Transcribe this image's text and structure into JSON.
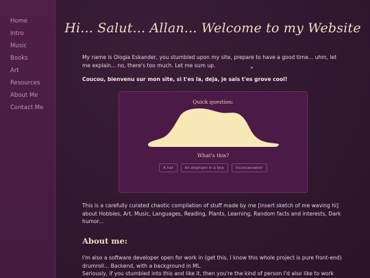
{
  "sidebar": {
    "items": [
      {
        "label": "Home"
      },
      {
        "label": "Intro"
      },
      {
        "label": "Music"
      },
      {
        "label": "Books"
      },
      {
        "label": "Art"
      },
      {
        "label": "Resources"
      },
      {
        "label": "About Me"
      },
      {
        "label": "Contact Me"
      }
    ]
  },
  "header": {
    "title": "Hi... Salut... Allan... Welcome to my Website"
  },
  "intro": {
    "line1": "My name is Ologia Eskander, you stumbled upon my site, prepare to have a good time... uhm, let me explain... no, there's too much. Let me sum up.",
    "line2": "Coucou, bienvenu sur mon site, si t'es la, deja, je sais t'es grove cool!"
  },
  "quiz": {
    "question": "Quick question:",
    "subquestion": "What's this?",
    "options": [
      "A hat",
      "An elephant in a boa",
      "Inconceivable!"
    ],
    "drawing_icon": "hat-elephant-drawing",
    "drawing_color": "#f7e8b5"
  },
  "description": {
    "text": "This is a carefully curated chaotic compilation of stuff made by me [insert sketch of me waving hi] about Hobbies, Art, Music, Languages, Reading, Plants, Learning, Random facts and interests, Dark humor..."
  },
  "about": {
    "heading": "About me:",
    "line1": "I'm also a software developer open for work in (get this, I know this whole project is pure front-end) drumroll... Backend, with a background in ML.",
    "line2": "Seriously, if you stumbled into this and like it, then you're the kind of person I'd also like to work with,"
  },
  "colors": {
    "sidebar_bg": "#4f1f48",
    "main_bg": "#311830",
    "card_bg": "#4c1a47",
    "title_color": "#f2dcc0"
  }
}
